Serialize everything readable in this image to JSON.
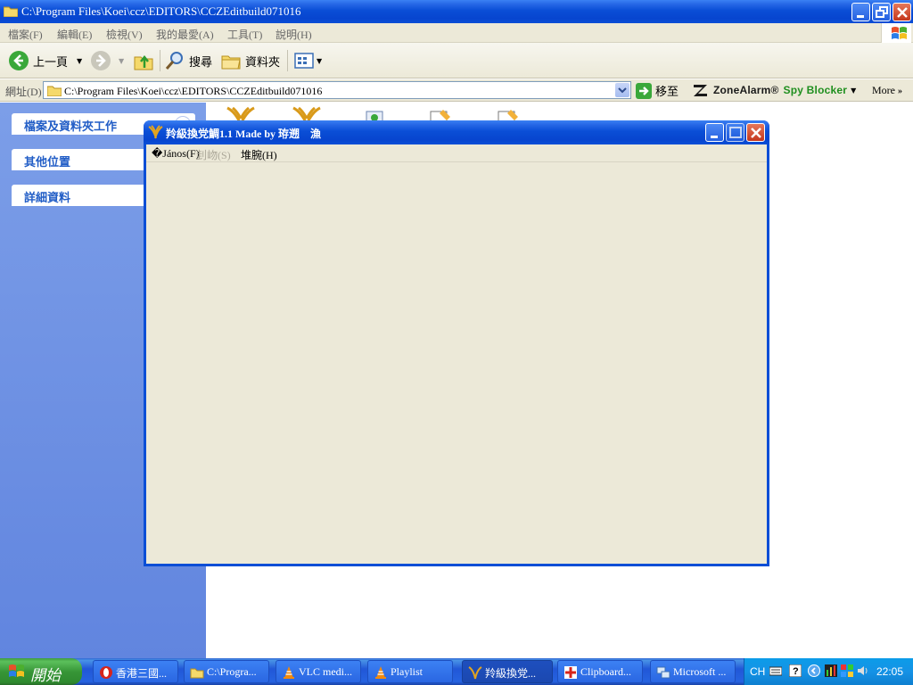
{
  "explorer": {
    "title": "C:\\Program Files\\Koei\\ccz\\EDITORS\\CCZEditbuild071016",
    "menu": [
      "檔案(F)",
      "編輯(E)",
      "檢視(V)",
      "我的最愛(A)",
      "工具(T)",
      "說明(H)"
    ],
    "toolbar": {
      "back": "上一頁",
      "search": "搜尋",
      "folders": "資料夾"
    },
    "address": {
      "label": "網址(D)",
      "value": "C:\\Program Files\\Koei\\ccz\\EDITORS\\CCZEditbuild071016",
      "go": "移至"
    },
    "zonealarm": {
      "brand": "ZoneAlarm®",
      "product": "Spy Blocker"
    },
    "more": "More",
    "task_panels": [
      "檔案及資料夾工作",
      "其他位置",
      "詳細資料"
    ]
  },
  "dialog": {
    "title": "羚級換党鯛1.1 Made by 珔遡　漁",
    "menu": [
      {
        "label": "�János(F)",
        "disabled": false
      },
      {
        "label": "刲岉(S)",
        "disabled": true
      },
      {
        "label": "堆腕(H)",
        "disabled": false
      }
    ]
  },
  "taskbar": {
    "start": "開始",
    "items": [
      {
        "label": "香港三國...",
        "icon": "opera-icon",
        "active": false
      },
      {
        "label": "C:\\Progra...",
        "icon": "folder-icon",
        "active": false
      },
      {
        "label": "VLC medi...",
        "icon": "vlc-cone-icon",
        "active": false
      },
      {
        "label": "Playlist",
        "icon": "vlc-cone-icon",
        "active": false
      },
      {
        "label": "羚級換党...",
        "icon": "phoenix-icon",
        "active": true
      },
      {
        "label": "Clipboard...",
        "icon": "clipboard-icon",
        "active": false
      },
      {
        "label": "Microsoft ...",
        "icon": "network-icon",
        "active": false
      }
    ],
    "tray": {
      "language": "CH",
      "clock": "22:05"
    }
  },
  "colors": {
    "xp_blue": "#0a4ed6",
    "taskpane": "#6d8fe3",
    "dialog_face": "#ece9d8",
    "start_green": "#379637",
    "zonealarm_green": "#1f8f1f"
  }
}
